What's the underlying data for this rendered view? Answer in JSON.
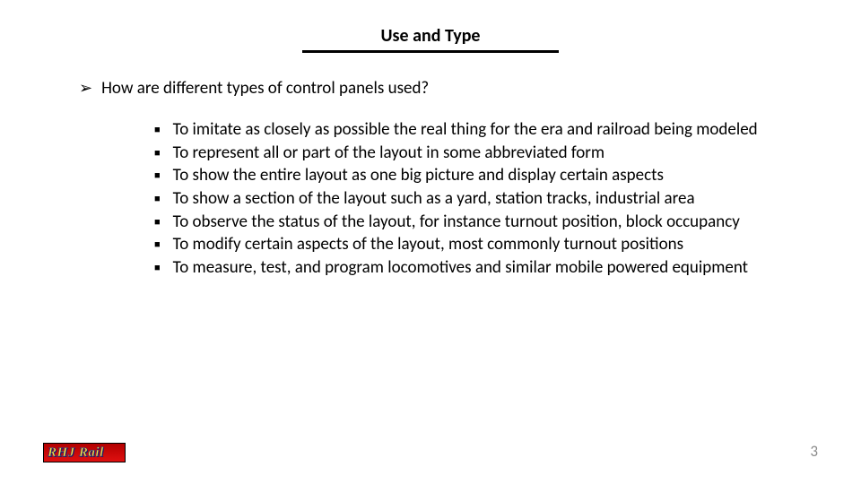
{
  "title": "Use and Type",
  "question": "How are different types of control panels used?",
  "bullets": [
    "To imitate as closely as possible the real thing for the era and railroad being modeled",
    "To represent all or part of the layout in some abbreviated form",
    "To show the entire layout as one big picture and display certain aspects",
    "To show a section of the layout such as a yard, station tracks, industrial area",
    "To observe the status of the layout, for instance turnout position, block occupancy",
    "To modify certain aspects of the layout, most commonly turnout positions",
    "To measure, test, and program locomotives and similar mobile powered equipment"
  ],
  "footer": {
    "logo_text": "RHJ Rail",
    "page_number": "3"
  }
}
